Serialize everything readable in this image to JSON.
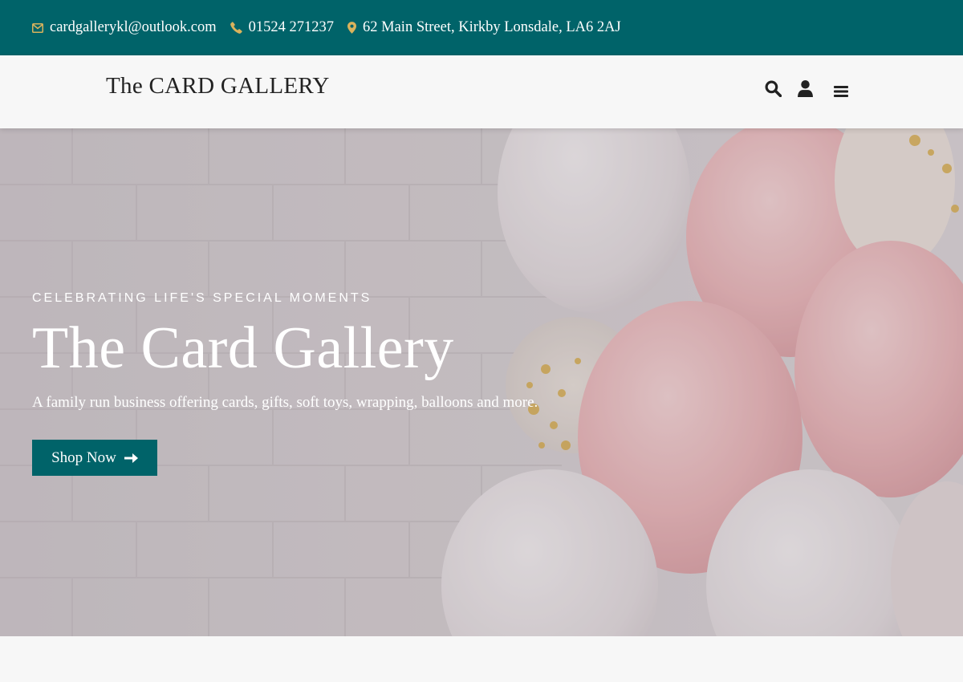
{
  "colors": {
    "brand": "#006369",
    "accent_icon": "#d9b35c",
    "text_dark": "#222222"
  },
  "topbar": {
    "email": "cardgallerykl@outlook.com",
    "phone": "01524 271237",
    "address": "62 Main Street, Kirkby Lonsdale, LA6 2AJ",
    "icons": [
      "envelope-icon",
      "phone-icon",
      "map-pin-icon"
    ]
  },
  "header": {
    "logo": "The CARD GALLERY",
    "icons": [
      "search-icon",
      "user-icon",
      "menu-icon"
    ]
  },
  "hero": {
    "eyebrow": "CELEBRATING LIFE'S SPECIAL MOMENTS",
    "title": "The Card Gallery",
    "subtitle": "A family run business offering cards, gifts, soft toys, wrapping, balloons and more.",
    "cta_label": "Shop Now",
    "cta_icon": "arrow-right-icon"
  }
}
